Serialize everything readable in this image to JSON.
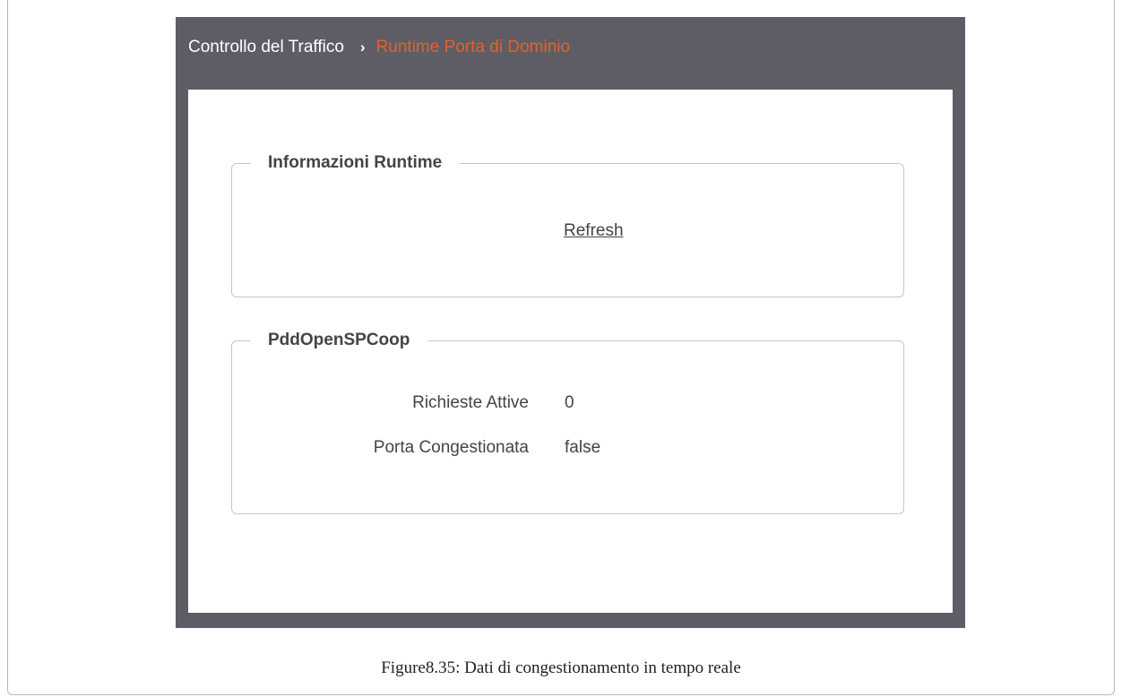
{
  "breadcrumb": {
    "root": "Controllo del Traffico",
    "separator": "›",
    "current": "Runtime Porta di Dominio"
  },
  "sections": {
    "runtime": {
      "legend": "Informazioni Runtime",
      "refresh_label": "Refresh"
    },
    "pdd": {
      "legend": "PddOpenSPCoop",
      "rows": [
        {
          "label": "Richieste Attive",
          "value": "0"
        },
        {
          "label": "Porta Congestionata",
          "value": "false"
        }
      ]
    }
  },
  "caption": "Figure8.35: Dati di congestionamento in tempo reale",
  "colors": {
    "header_bg": "#5e5d65",
    "accent": "#e2622f"
  }
}
